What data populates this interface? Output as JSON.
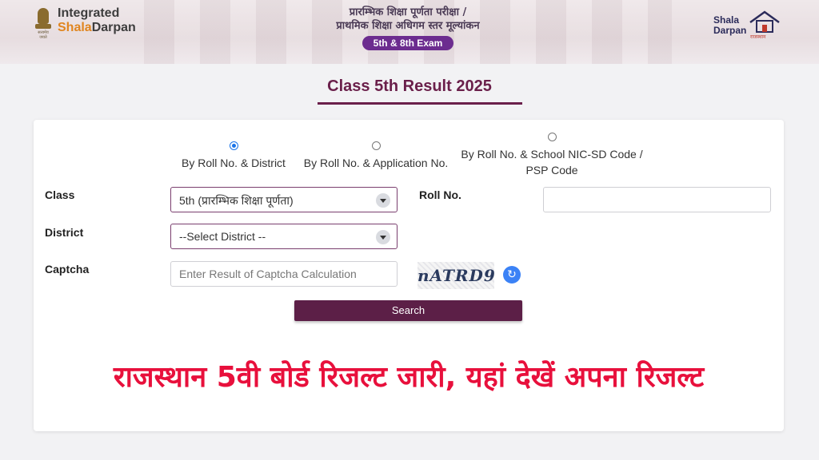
{
  "header": {
    "brand_line1": "Integrated",
    "brand_line2_prefix": "Shala",
    "brand_line2_suffix": "Darpan",
    "emblem_caption": "सत्यमेव जयते",
    "title_line1": "प्रारम्भिक शिक्षा पूर्णता परीक्षा /",
    "title_line2": "प्राथमिक शिक्षा अधिगम स्तर मूल्यांकन",
    "exam_badge": "5th & 8th Exam",
    "right_logo_line1": "Shala",
    "right_logo_line2": "Darpan",
    "right_logo_tag": "राजस्थान"
  },
  "page_title": "Class 5th Result 2025",
  "search_modes": [
    {
      "label": "By Roll No. & District",
      "selected": true
    },
    {
      "label": "By Roll No. & Application No.",
      "selected": false
    },
    {
      "label_line1": "By Roll No. & School NIC-SD Code /",
      "label_line2": "PSP Code",
      "selected": false
    }
  ],
  "form": {
    "class_label": "Class",
    "class_value": "5th (प्रारम्भिक शिक्षा पूर्णता)",
    "roll_label": "Roll No.",
    "roll_value": "",
    "district_label": "District",
    "district_value": "--Select District --",
    "captcha_label": "Captcha",
    "captcha_placeholder": "Enter Result of Captcha Calculation",
    "captcha_text": "nATRD9",
    "search_label": "Search"
  },
  "headline": "राजस्थान 5वी बोर्ड रिजल्ट जारी, यहां देखें अपना रिजल्ट",
  "colors": {
    "primary": "#5c1f47",
    "title": "#6a1f4a",
    "badge": "#6c2c8f",
    "headline": "#e8103c",
    "radio_selected": "#1a73e8"
  }
}
